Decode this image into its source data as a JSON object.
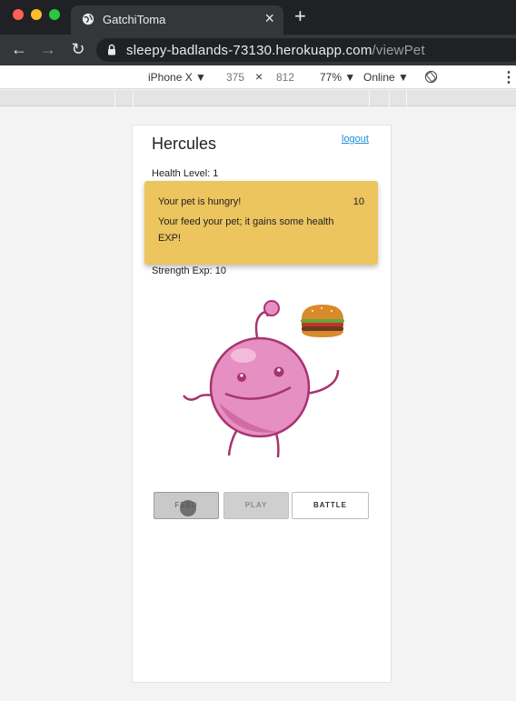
{
  "browser": {
    "tab_title": "GatchiToma",
    "tab_close": "×",
    "new_tab": "+",
    "url_host": "sleepy-badlands-73130.herokuapp.com",
    "url_path": "/viewPet",
    "back": "←",
    "forward": "→",
    "reload": "↻"
  },
  "devtools": {
    "device": "iPhone X ▼",
    "width": "375",
    "times": "×",
    "height": "812",
    "zoom": "77% ▼",
    "network": "Online ▼",
    "more": "⋮"
  },
  "page": {
    "pet_name": "Hercules",
    "logout": "logout",
    "health_level": "Health Level: 1",
    "strength_exp": "Strength Exp: 10"
  },
  "toast": {
    "title": "Your pet is hungry!",
    "count": "10",
    "message": "Your feed your pet; it gains some health EXP!"
  },
  "actions": {
    "feed": "FEED",
    "play": "PLAY",
    "battle": "BATTLE"
  },
  "colors": {
    "toast_bg": "#ecc55f",
    "pet_pink": "#e68fc3",
    "pet_outline": "#a8346f",
    "link": "#1a8fd6"
  }
}
